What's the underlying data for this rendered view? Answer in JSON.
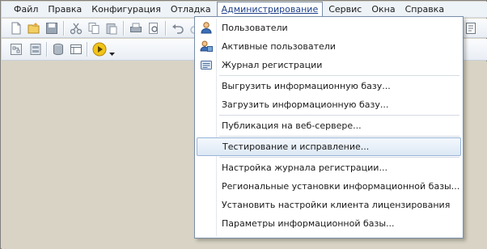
{
  "menubar": {
    "items": [
      {
        "label": "Файл"
      },
      {
        "label": "Правка"
      },
      {
        "label": "Конфигурация"
      },
      {
        "label": "Отладка"
      },
      {
        "label": "Администрирование"
      },
      {
        "label": "Сервис"
      },
      {
        "label": "Окна"
      },
      {
        "label": "Справка"
      }
    ]
  },
  "admin_menu": {
    "items": [
      {
        "label": "Пользователи",
        "icon": "user-icon"
      },
      {
        "label": "Активные пользователи",
        "icon": "active-users-icon"
      },
      {
        "label": "Журнал регистрации",
        "icon": "event-log-icon"
      },
      {
        "label": "Выгрузить информационную базу..."
      },
      {
        "label": "Загрузить информационную базу..."
      },
      {
        "label": "Публикация на веб-сервере..."
      },
      {
        "label": "Тестирование и исправление...",
        "highlighted": true
      },
      {
        "label": "Настройка журнала регистрации..."
      },
      {
        "label": "Региональные установки информационной базы..."
      },
      {
        "label": "Установить настройки клиента лицензирования"
      },
      {
        "label": "Параметры информационной базы..."
      }
    ]
  },
  "colors": {
    "menubar_bg": "#eef3f8",
    "workspace_bg": "#d8d3c4",
    "highlight_border": "#98b4d6",
    "active_menu_text": "#1c3f8a"
  }
}
